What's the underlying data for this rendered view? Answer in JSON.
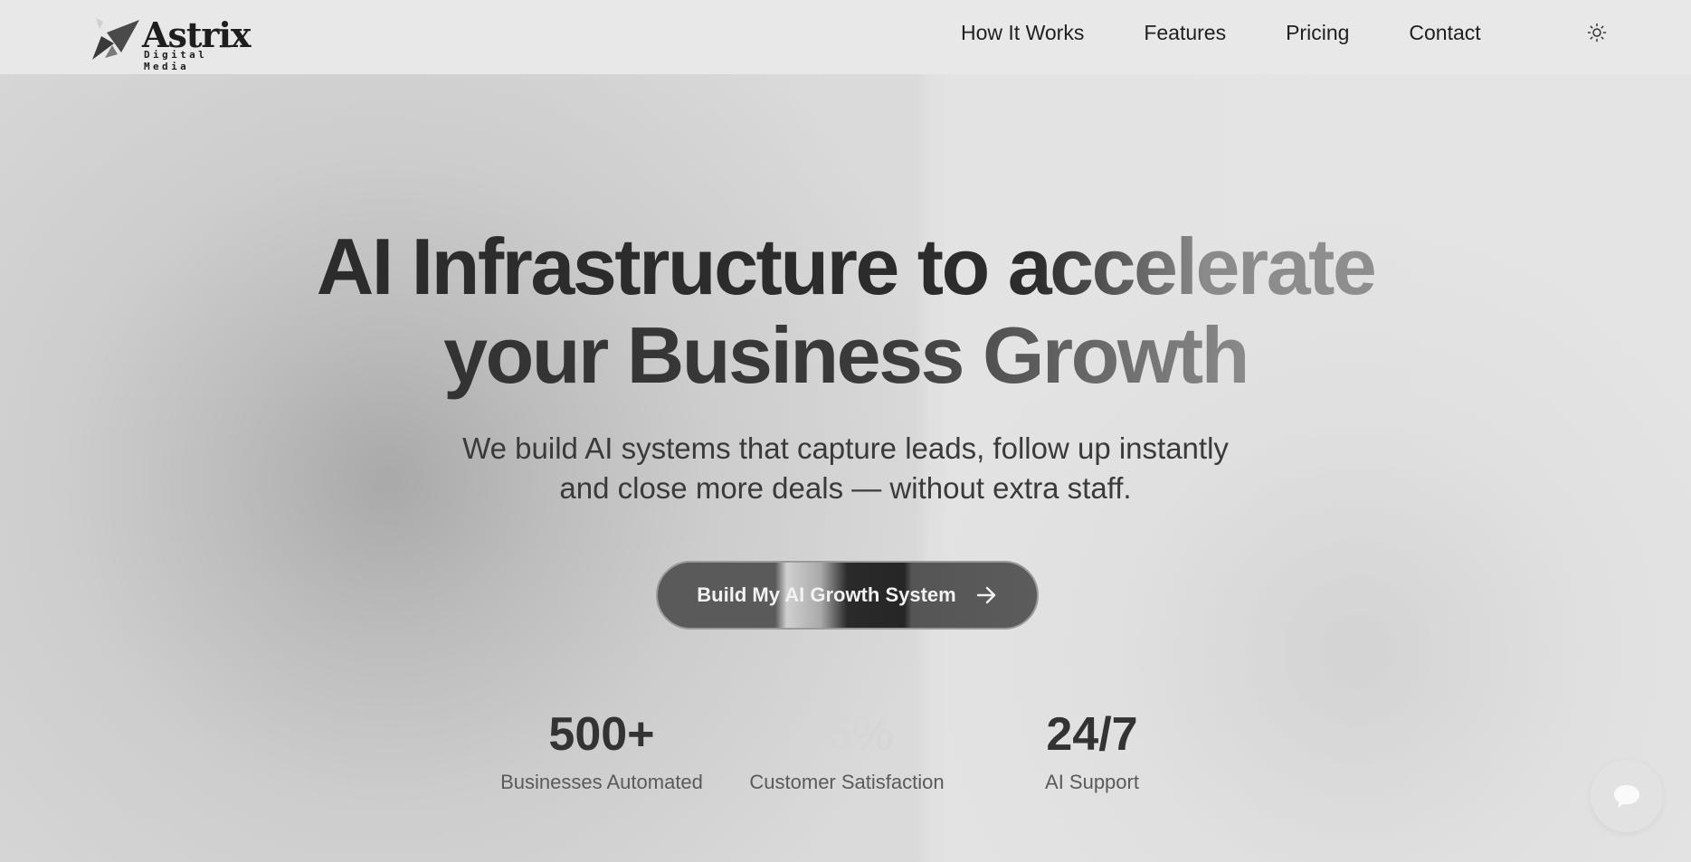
{
  "brand": {
    "name": "Astrix",
    "tagline": "Digital Media"
  },
  "nav": {
    "items": [
      {
        "label": "How It Works"
      },
      {
        "label": "Features"
      },
      {
        "label": "Pricing"
      },
      {
        "label": "Contact"
      }
    ],
    "theme_icon": "sun-icon"
  },
  "hero": {
    "title_line1": "AI Infrastructure to accelerate",
    "title_line2": "your Business Growth",
    "subtitle_line1": "We build AI systems that capture leads, follow up instantly",
    "subtitle_line2": "and close more deals — without extra staff.",
    "cta_label": "Build My AI Growth System",
    "cta_icon": "arrow-right-icon"
  },
  "stats": [
    {
      "value": "500+",
      "label": "Businesses Automated"
    },
    {
      "value": "95%",
      "label": "Customer Satisfaction"
    },
    {
      "value": "24/7",
      "label": "AI Support"
    }
  ],
  "chat": {
    "icon": "chat-bubble-icon"
  },
  "colors": {
    "background": "#e6e6e6",
    "text": "#2e2e2e",
    "cta_dark": "#2a2a2a"
  }
}
